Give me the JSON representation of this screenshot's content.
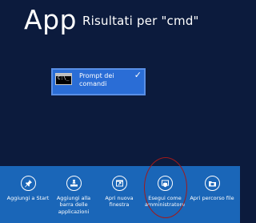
{
  "header": {
    "title": "App",
    "results": "Risultati per \"cmd\""
  },
  "results": [
    {
      "label_line1": "Prompt dei",
      "label_line2": "comandi",
      "icon": "command-prompt-icon",
      "selected": true,
      "check": "✓"
    }
  ],
  "app_bar": {
    "items": [
      {
        "label_line1": "Aggiungi a Start",
        "label_line2": "",
        "label_line3": "",
        "icon": "pin-icon"
      },
      {
        "label_line1": "Aggiungi alla",
        "label_line2": "barra delle",
        "label_line3": "applicazioni",
        "icon": "taskbar-pin-icon"
      },
      {
        "label_line1": "Apri nuova",
        "label_line2": "finestra",
        "label_line3": "",
        "icon": "new-window-icon"
      },
      {
        "label_line1": "Esegui come",
        "label_line2": "amministratore",
        "label_line3": "",
        "icon": "run-as-admin-icon"
      },
      {
        "label_line1": "Apri percorso file",
        "label_line2": "",
        "label_line3": "",
        "icon": "open-file-location-icon"
      }
    ]
  },
  "colors": {
    "background": "#0c1b3d",
    "tile": "#2a6dd6",
    "app_bar": "#1a66b8",
    "highlight": "#a11a1a"
  }
}
